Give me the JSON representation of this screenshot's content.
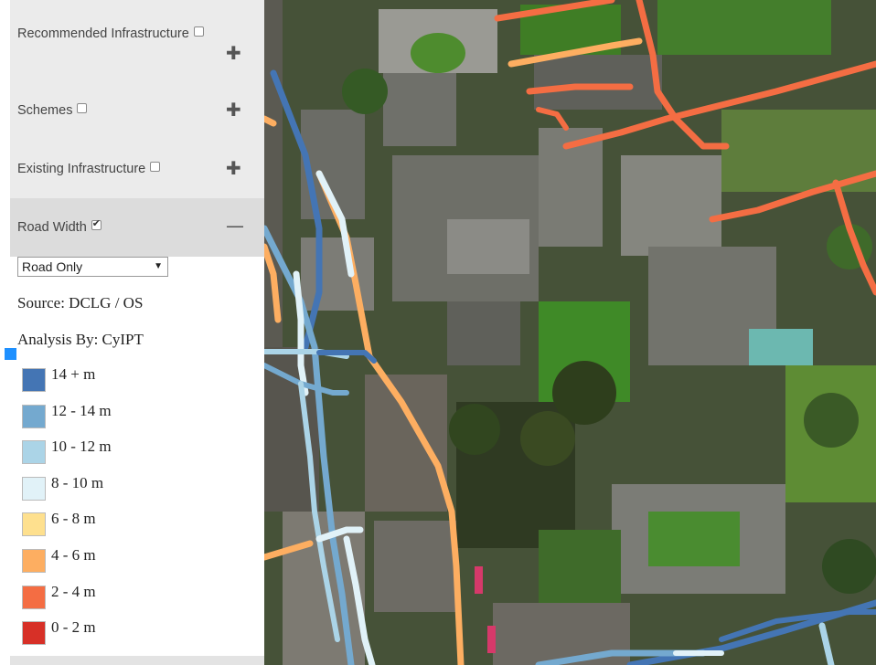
{
  "sidebar": {
    "layers": [
      {
        "label": "Recommended Infrastructure",
        "checked": false,
        "toggle": "✚"
      },
      {
        "label": "Schemes",
        "checked": false,
        "toggle": "✚"
      },
      {
        "label": "Existing Infrastructure",
        "checked": false,
        "toggle": "✚"
      },
      {
        "label": "Road Width",
        "checked": true,
        "toggle": "—"
      }
    ],
    "select": {
      "value": "Road Only"
    },
    "source": "Source: DCLG / OS",
    "analysis": "Analysis By: CyIPT",
    "legend": [
      {
        "label": "14 + m",
        "color": "#4475b4"
      },
      {
        "label": "12 - 14 m",
        "color": "#74a9cf"
      },
      {
        "label": "10 - 12 m",
        "color": "#abd4e7"
      },
      {
        "label": "8 - 10 m",
        "color": "#e1f2f8"
      },
      {
        "label": "6 - 8 m",
        "color": "#fee08e"
      },
      {
        "label": "4 - 6 m",
        "color": "#fdae61"
      },
      {
        "label": "2 - 4 m",
        "color": "#f46d43"
      },
      {
        "label": "0 - 2 m",
        "color": "#d73027"
      }
    ]
  },
  "map": {
    "imagery": "satellite-aerial"
  }
}
